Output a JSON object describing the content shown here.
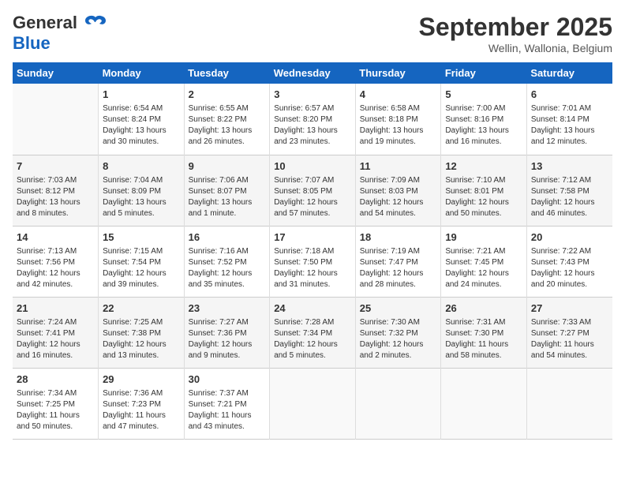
{
  "header": {
    "logo_line1": "General",
    "logo_line2": "Blue",
    "month": "September 2025",
    "location": "Wellin, Wallonia, Belgium"
  },
  "days_of_week": [
    "Sunday",
    "Monday",
    "Tuesday",
    "Wednesday",
    "Thursday",
    "Friday",
    "Saturday"
  ],
  "weeks": [
    [
      {
        "num": "",
        "sunrise": "",
        "sunset": "",
        "daylight": ""
      },
      {
        "num": "1",
        "sunrise": "Sunrise: 6:54 AM",
        "sunset": "Sunset: 8:24 PM",
        "daylight": "Daylight: 13 hours and 30 minutes."
      },
      {
        "num": "2",
        "sunrise": "Sunrise: 6:55 AM",
        "sunset": "Sunset: 8:22 PM",
        "daylight": "Daylight: 13 hours and 26 minutes."
      },
      {
        "num": "3",
        "sunrise": "Sunrise: 6:57 AM",
        "sunset": "Sunset: 8:20 PM",
        "daylight": "Daylight: 13 hours and 23 minutes."
      },
      {
        "num": "4",
        "sunrise": "Sunrise: 6:58 AM",
        "sunset": "Sunset: 8:18 PM",
        "daylight": "Daylight: 13 hours and 19 minutes."
      },
      {
        "num": "5",
        "sunrise": "Sunrise: 7:00 AM",
        "sunset": "Sunset: 8:16 PM",
        "daylight": "Daylight: 13 hours and 16 minutes."
      },
      {
        "num": "6",
        "sunrise": "Sunrise: 7:01 AM",
        "sunset": "Sunset: 8:14 PM",
        "daylight": "Daylight: 13 hours and 12 minutes."
      }
    ],
    [
      {
        "num": "7",
        "sunrise": "Sunrise: 7:03 AM",
        "sunset": "Sunset: 8:12 PM",
        "daylight": "Daylight: 13 hours and 8 minutes."
      },
      {
        "num": "8",
        "sunrise": "Sunrise: 7:04 AM",
        "sunset": "Sunset: 8:09 PM",
        "daylight": "Daylight: 13 hours and 5 minutes."
      },
      {
        "num": "9",
        "sunrise": "Sunrise: 7:06 AM",
        "sunset": "Sunset: 8:07 PM",
        "daylight": "Daylight: 13 hours and 1 minute."
      },
      {
        "num": "10",
        "sunrise": "Sunrise: 7:07 AM",
        "sunset": "Sunset: 8:05 PM",
        "daylight": "Daylight: 12 hours and 57 minutes."
      },
      {
        "num": "11",
        "sunrise": "Sunrise: 7:09 AM",
        "sunset": "Sunset: 8:03 PM",
        "daylight": "Daylight: 12 hours and 54 minutes."
      },
      {
        "num": "12",
        "sunrise": "Sunrise: 7:10 AM",
        "sunset": "Sunset: 8:01 PM",
        "daylight": "Daylight: 12 hours and 50 minutes."
      },
      {
        "num": "13",
        "sunrise": "Sunrise: 7:12 AM",
        "sunset": "Sunset: 7:58 PM",
        "daylight": "Daylight: 12 hours and 46 minutes."
      }
    ],
    [
      {
        "num": "14",
        "sunrise": "Sunrise: 7:13 AM",
        "sunset": "Sunset: 7:56 PM",
        "daylight": "Daylight: 12 hours and 42 minutes."
      },
      {
        "num": "15",
        "sunrise": "Sunrise: 7:15 AM",
        "sunset": "Sunset: 7:54 PM",
        "daylight": "Daylight: 12 hours and 39 minutes."
      },
      {
        "num": "16",
        "sunrise": "Sunrise: 7:16 AM",
        "sunset": "Sunset: 7:52 PM",
        "daylight": "Daylight: 12 hours and 35 minutes."
      },
      {
        "num": "17",
        "sunrise": "Sunrise: 7:18 AM",
        "sunset": "Sunset: 7:50 PM",
        "daylight": "Daylight: 12 hours and 31 minutes."
      },
      {
        "num": "18",
        "sunrise": "Sunrise: 7:19 AM",
        "sunset": "Sunset: 7:47 PM",
        "daylight": "Daylight: 12 hours and 28 minutes."
      },
      {
        "num": "19",
        "sunrise": "Sunrise: 7:21 AM",
        "sunset": "Sunset: 7:45 PM",
        "daylight": "Daylight: 12 hours and 24 minutes."
      },
      {
        "num": "20",
        "sunrise": "Sunrise: 7:22 AM",
        "sunset": "Sunset: 7:43 PM",
        "daylight": "Daylight: 12 hours and 20 minutes."
      }
    ],
    [
      {
        "num": "21",
        "sunrise": "Sunrise: 7:24 AM",
        "sunset": "Sunset: 7:41 PM",
        "daylight": "Daylight: 12 hours and 16 minutes."
      },
      {
        "num": "22",
        "sunrise": "Sunrise: 7:25 AM",
        "sunset": "Sunset: 7:38 PM",
        "daylight": "Daylight: 12 hours and 13 minutes."
      },
      {
        "num": "23",
        "sunrise": "Sunrise: 7:27 AM",
        "sunset": "Sunset: 7:36 PM",
        "daylight": "Daylight: 12 hours and 9 minutes."
      },
      {
        "num": "24",
        "sunrise": "Sunrise: 7:28 AM",
        "sunset": "Sunset: 7:34 PM",
        "daylight": "Daylight: 12 hours and 5 minutes."
      },
      {
        "num": "25",
        "sunrise": "Sunrise: 7:30 AM",
        "sunset": "Sunset: 7:32 PM",
        "daylight": "Daylight: 12 hours and 2 minutes."
      },
      {
        "num": "26",
        "sunrise": "Sunrise: 7:31 AM",
        "sunset": "Sunset: 7:30 PM",
        "daylight": "Daylight: 11 hours and 58 minutes."
      },
      {
        "num": "27",
        "sunrise": "Sunrise: 7:33 AM",
        "sunset": "Sunset: 7:27 PM",
        "daylight": "Daylight: 11 hours and 54 minutes."
      }
    ],
    [
      {
        "num": "28",
        "sunrise": "Sunrise: 7:34 AM",
        "sunset": "Sunset: 7:25 PM",
        "daylight": "Daylight: 11 hours and 50 minutes."
      },
      {
        "num": "29",
        "sunrise": "Sunrise: 7:36 AM",
        "sunset": "Sunset: 7:23 PM",
        "daylight": "Daylight: 11 hours and 47 minutes."
      },
      {
        "num": "30",
        "sunrise": "Sunrise: 7:37 AM",
        "sunset": "Sunset: 7:21 PM",
        "daylight": "Daylight: 11 hours and 43 minutes."
      },
      {
        "num": "",
        "sunrise": "",
        "sunset": "",
        "daylight": ""
      },
      {
        "num": "",
        "sunrise": "",
        "sunset": "",
        "daylight": ""
      },
      {
        "num": "",
        "sunrise": "",
        "sunset": "",
        "daylight": ""
      },
      {
        "num": "",
        "sunrise": "",
        "sunset": "",
        "daylight": ""
      }
    ]
  ]
}
